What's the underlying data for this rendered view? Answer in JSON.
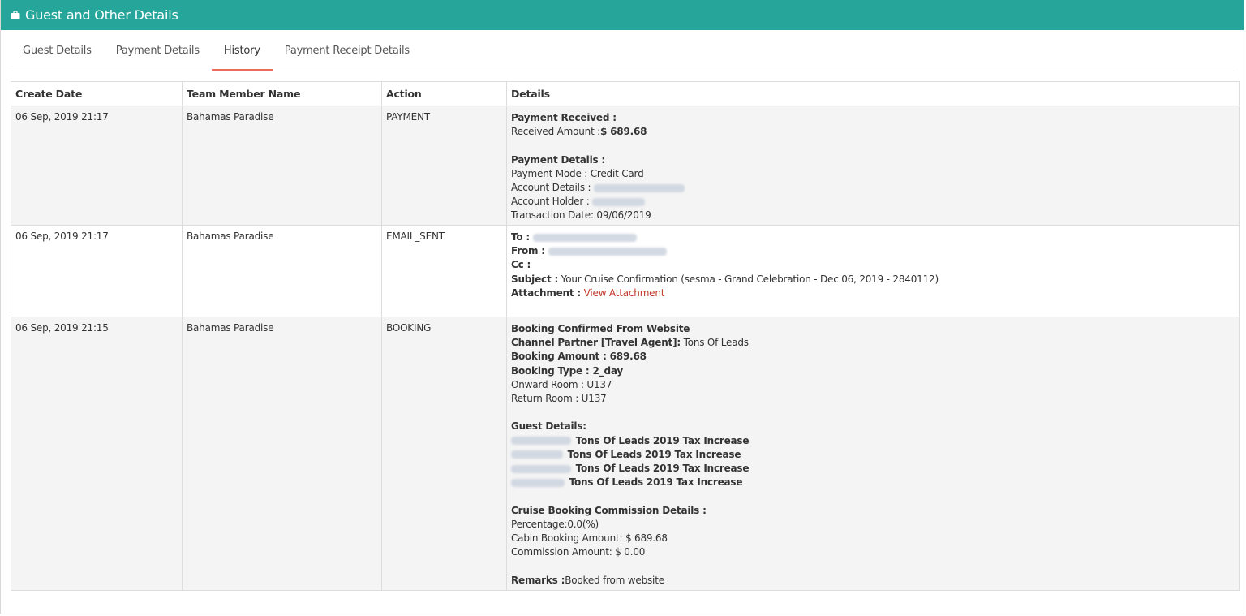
{
  "header": {
    "title": "Guest and Other Details",
    "icon": "briefcase-icon"
  },
  "tabs": [
    {
      "label": "Guest Details"
    },
    {
      "label": "Payment Details"
    },
    {
      "label": "History"
    },
    {
      "label": "Payment Receipt Details"
    }
  ],
  "active_tab": "History",
  "colors": {
    "header_bg": "#26a69a",
    "active_tab_underline": "#e5533c",
    "link": "#c0392b",
    "row_alt": "#f4f4f4"
  },
  "table": {
    "headers": [
      "Create Date",
      "Team Member Name",
      "Action",
      "Details"
    ],
    "rows": [
      {
        "create_date": "06 Sep, 2019 21:17",
        "team_member": "Bahamas Paradise",
        "action": "PAYMENT",
        "details": {
          "payment_received_label": "Payment Received :",
          "received_amount_label": "Received Amount :",
          "received_amount_value": "$ 689.68",
          "payment_details_label": "Payment Details :",
          "payment_mode": "Payment Mode : Credit Card",
          "account_details_label": "Account Details :",
          "account_holder_label": "Account Holder :",
          "transaction_date": "Transaction Date: 09/06/2019"
        }
      },
      {
        "create_date": "06 Sep, 2019 21:17",
        "team_member": "Bahamas Paradise",
        "action": "EMAIL_SENT",
        "details": {
          "to_label": "To :",
          "from_label": "From :",
          "cc_label": "Cc :",
          "subject_label": "Subject :",
          "subject_value": " Your Cruise Confirmation (sesma - Grand Celebration - Dec 06, 2019 - 2840112)",
          "attachment_label": "Attachment :",
          "attachment_link": "View Attachment"
        }
      },
      {
        "create_date": "06 Sep, 2019 21:15",
        "team_member": "Bahamas Paradise",
        "action": "BOOKING",
        "details": {
          "booking_confirmed": "Booking Confirmed From Website",
          "channel_partner_label": "Channel Partner [Travel Agent]:",
          "channel_partner_value": " Tons Of Leads",
          "booking_amount": "Booking Amount : 689.68",
          "booking_type": "Booking Type : 2_day",
          "onward_room": "Onward Room : U137",
          "return_room": "Return Room : U137",
          "guest_details_label": "Guest Details:",
          "guests": [
            {
              "suffix": "Tons Of Leads 2019 Tax Increase"
            },
            {
              "suffix": "Tons Of Leads 2019 Tax Increase"
            },
            {
              "suffix": "Tons Of Leads 2019 Tax Increase"
            },
            {
              "suffix": "Tons Of Leads 2019 Tax Increase"
            }
          ],
          "commission_label": "Cruise Booking Commission Details :",
          "percentage": "Percentage:0.0(%)",
          "cabin_booking_amount": "Cabin Booking Amount: $ 689.68",
          "commission_amount": "Commission Amount: $ 0.00",
          "remarks_label": "Remarks :",
          "remarks_value": "Booked from website"
        }
      }
    ]
  }
}
